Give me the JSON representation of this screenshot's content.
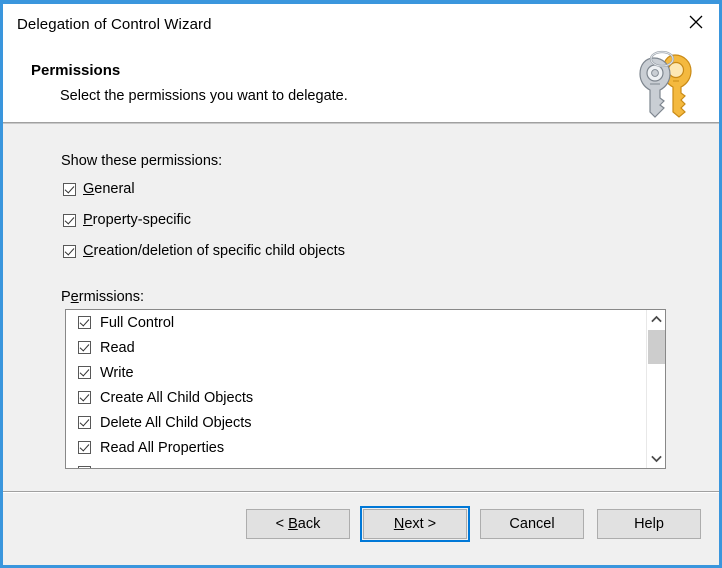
{
  "window": {
    "title": "Delegation of Control Wizard",
    "close_icon": "close-icon"
  },
  "header": {
    "title": "Permissions",
    "subtitle": "Select the permissions you want to delegate.",
    "icon": "keys-icon"
  },
  "body": {
    "show_label": "Show these permissions:",
    "permissions_label": "Permissions:",
    "show_options": [
      {
        "label": "General",
        "accel": "G",
        "checked": true
      },
      {
        "label": "Property-specific",
        "accel": "P",
        "checked": true
      },
      {
        "label": "Creation/deletion of specific child objects",
        "accel": "C",
        "checked": true
      }
    ],
    "permissions_list": [
      {
        "label": "Full Control",
        "checked": true
      },
      {
        "label": "Read",
        "checked": true
      },
      {
        "label": "Write",
        "checked": true
      },
      {
        "label": "Create All Child Objects",
        "checked": true
      },
      {
        "label": "Delete All Child Objects",
        "checked": true
      },
      {
        "label": "Read All Properties",
        "checked": true
      }
    ],
    "scrollbar": {
      "up_icon": "chevron-up-icon",
      "down_icon": "chevron-down-icon",
      "thumb_position": "near-top"
    }
  },
  "footer": {
    "buttons": [
      {
        "label": "< Back",
        "accel": "B",
        "default": false
      },
      {
        "label": "Next >",
        "accel": "N",
        "default": true
      },
      {
        "label": "Cancel",
        "accel": "",
        "default": false
      },
      {
        "label": "Help",
        "accel": "",
        "default": false
      }
    ]
  },
  "colors": {
    "window_border": "#3a96dd",
    "body_background": "#f0f0f0",
    "header_background": "#ffffff",
    "focus_ring": "#0078d7",
    "separator": "#a0a0a0",
    "scrollbar_thumb": "#cdcdcd",
    "key_gold": "#f0a830",
    "key_silver": "#b8bcc2"
  }
}
